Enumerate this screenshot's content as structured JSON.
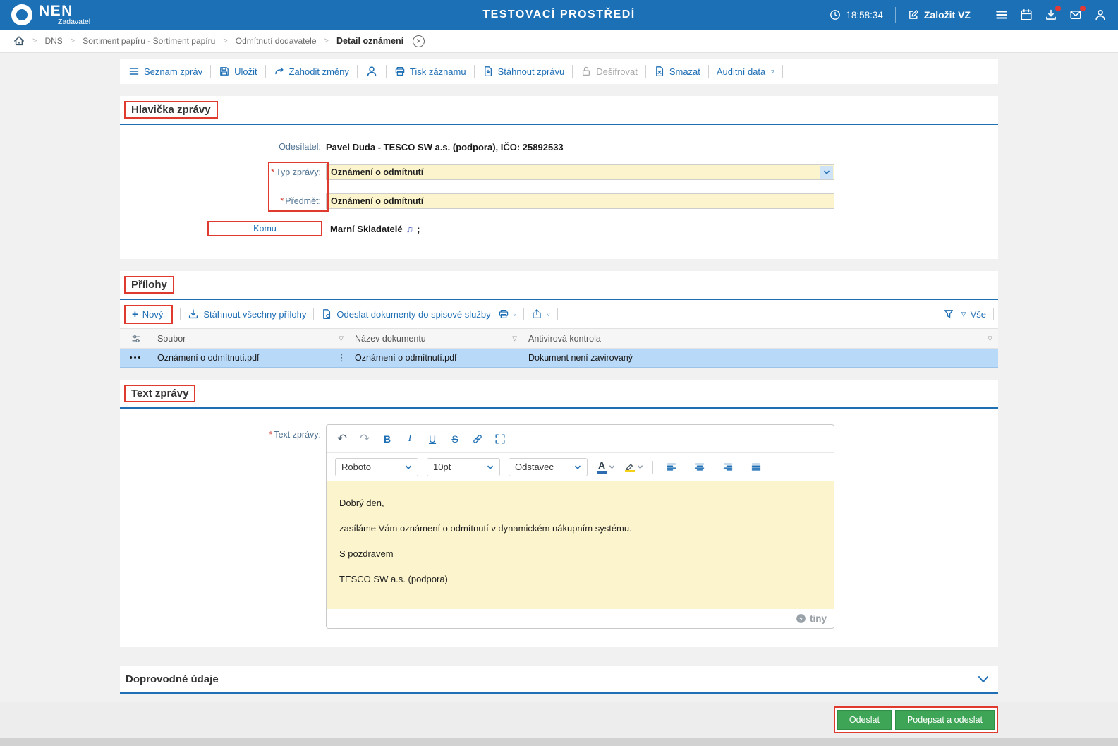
{
  "topbar": {
    "brand": "NEN",
    "role": "Zadavatel",
    "environment": "TESTOVACÍ PROSTŘEDÍ",
    "time": "18:58:34",
    "create_vz": "Založit VZ"
  },
  "breadcrumb": {
    "items": [
      "DNS",
      "Sortiment papíru - Sortiment papíru",
      "Odmítnutí dodavatele",
      "Detail oznámení"
    ]
  },
  "toolbar": {
    "seznam_zprav": "Seznam zpráv",
    "ulozit": "Uložit",
    "zahodit_zmeny": "Zahodit změny",
    "tisk_zaznamu": "Tisk záznamu",
    "stahnout_zpravu": "Stáhnout zprávu",
    "desifrovat": "Dešifrovat",
    "smazat": "Smazat",
    "auditni_data": "Auditní data"
  },
  "hlavicka": {
    "title": "Hlavička zprávy",
    "odesilatel_label": "Odesílatel:",
    "odesilatel_value": "Pavel Duda - TESCO SW a.s. (podpora), IČO: 25892533",
    "typ_zpravy_label": "Typ zprávy:",
    "typ_zpravy_value": "Oznámení o odmítnutí",
    "predmet_label": "Předmět:",
    "predmet_value": "Oznámení o odmítnutí",
    "komu_label": "Komu",
    "komu_value": "Marní Skladatelé",
    "komu_suffix": ";"
  },
  "prilohy": {
    "title": "Přílohy",
    "novy": "Nový",
    "stahnout_vsechny": "Stáhnout všechny přílohy",
    "odeslat_dokumenty": "Odeslat dokumenty do spisové služby",
    "vse": "Vše",
    "columns": [
      "Soubor",
      "Název dokumentu",
      "Antivirová kontrola"
    ],
    "rows": [
      {
        "soubor": "Oznámení o odmítnutí.pdf",
        "nazev_dokumentu": "Oznámení o odmítnutí.pdf",
        "antivirova_kontrola": "Dokument není zavirovaný"
      }
    ]
  },
  "text_zpravy": {
    "title": "Text zprávy",
    "label": "Text zprávy:",
    "font_family_value": "Roboto",
    "font_size_value": "10pt",
    "block_value": "Odstavec",
    "paragraphs": [
      "Dobrý den,",
      "zasíláme Vám oznámení o odmítnutí v dynamickém nákupním systému.",
      "S pozdravem",
      "TESCO SW a.s. (podpora)"
    ],
    "editor_brand": "tiny"
  },
  "doprovodne": {
    "title": "Doprovodné údaje"
  },
  "footer": {
    "odeslat": "Odeslat",
    "podepsat_a_odeslat": "Podepsat a odeslat"
  },
  "icons": {
    "required": "*",
    "crumb_separator": ">",
    "close": "×",
    "undo": "↶",
    "redo": "↷",
    "bold": "B",
    "italic": "I",
    "underline": "U",
    "strikethrough": "S",
    "font_color": "A",
    "row_menu": "•••",
    "row_drag": "⋮",
    "filter_triangle": "▽",
    "plus": "+",
    "dropdown_small": "▿",
    "recipient_glyph": "♫"
  },
  "colors": {
    "topbar_blue": "#1b70b6",
    "accent_blue": "#1f6fb5",
    "annotation_red": "#e0392e",
    "field_yellow": "#fbf4cc",
    "selected_row_blue": "#b9d9f8",
    "button_green": "#3fa556",
    "badge_red": "#e53935"
  }
}
